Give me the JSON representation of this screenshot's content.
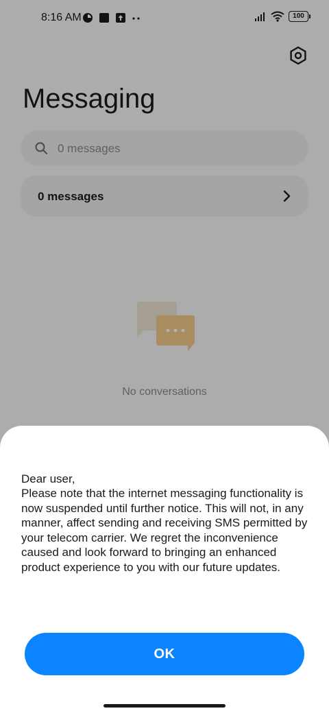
{
  "status_bar": {
    "time": "8:16 AM",
    "battery": "100",
    "icons": [
      "data-saver-icon",
      "square-notification-icon",
      "upload-icon",
      "more-dots-icon",
      "signal-icon",
      "wifi-icon",
      "battery-icon"
    ]
  },
  "header": {
    "title": "Messaging",
    "settings_icon": "gear-icon"
  },
  "search": {
    "placeholder": "0 messages"
  },
  "messages_row": {
    "label": "0 messages"
  },
  "empty_state": {
    "text": "No conversations"
  },
  "dialog": {
    "greeting": "Dear user,",
    "body": "Please note that the internet messaging functionality is now suspended until further notice. This will not, in any manner, affect sending and receiving SMS permitted by your telecom carrier. We regret the inconvenience caused and look forward to bringing an enhanced product experience to you with our future updates.",
    "ok_label": "OK"
  },
  "colors": {
    "accent": "#0d84ff",
    "illustration": "#f2c98a"
  }
}
